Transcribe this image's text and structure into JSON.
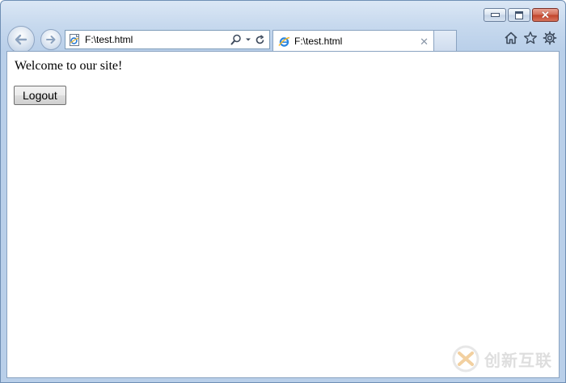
{
  "browser": {
    "address": "F:\\test.html",
    "tab_title": "F:\\test.html"
  },
  "page": {
    "welcome_text": "Welcome to our site!",
    "logout_label": "Logout"
  },
  "watermark": {
    "text": "创新互联"
  }
}
